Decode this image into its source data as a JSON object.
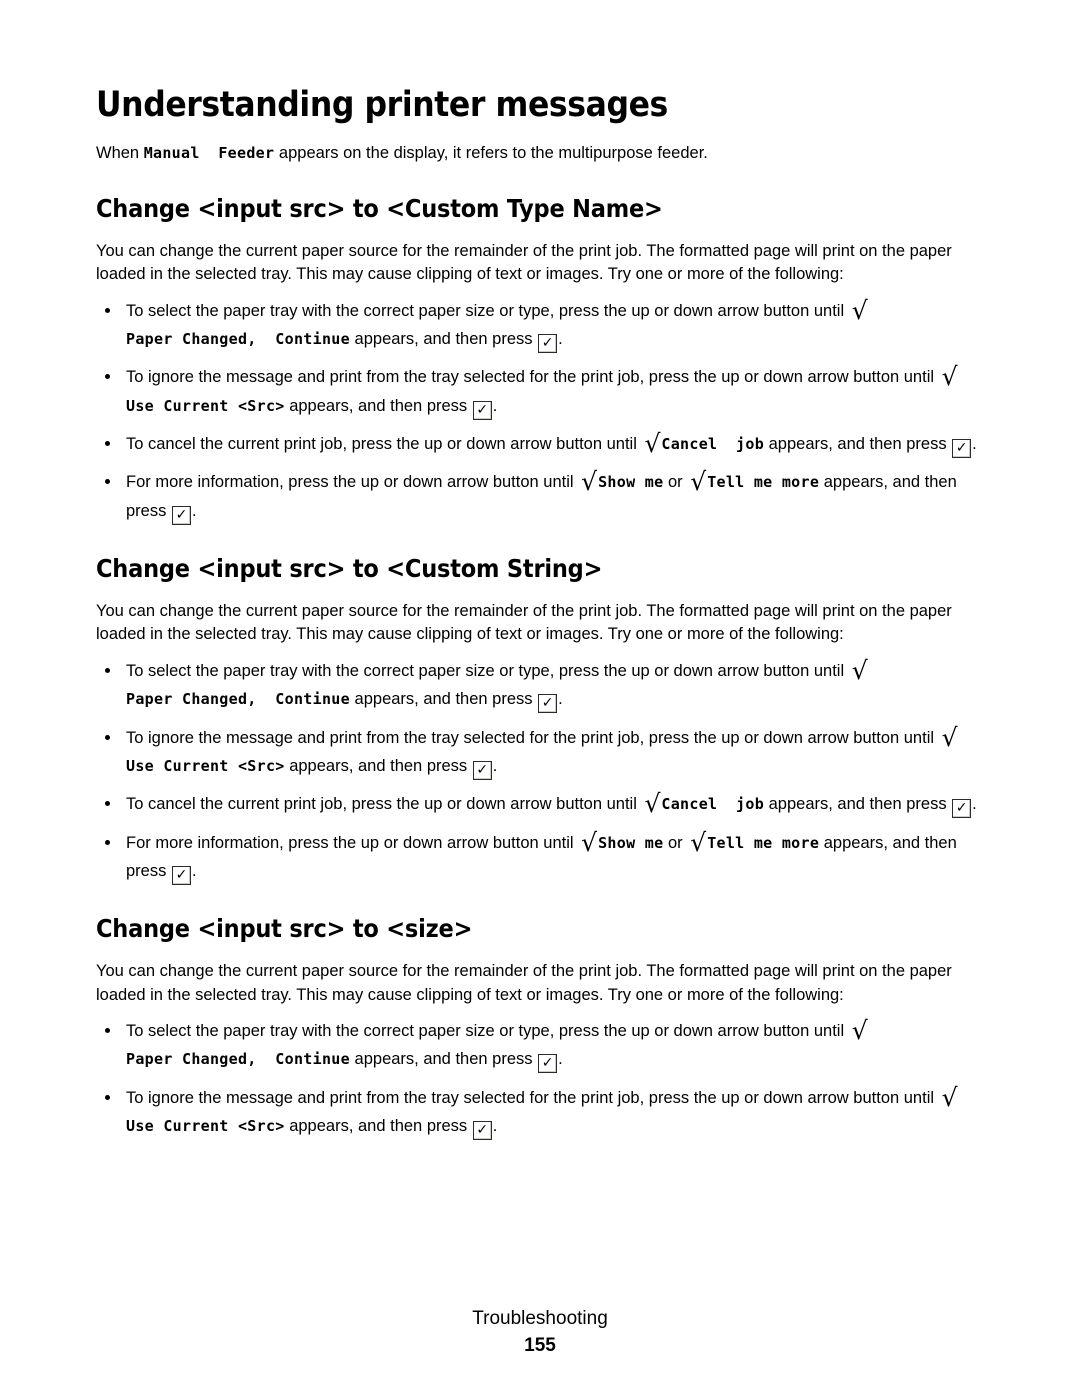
{
  "document": {
    "title": "Understanding printer messages",
    "intro": {
      "before": "When ",
      "mono": "Manual  Feeder",
      "after": " appears on the display, it refers to the multipurpose feeder."
    },
    "shared": {
      "paragraph_line1": "You can change the current paper source for the remainder of the print job. The formatted page will print on the",
      "paragraph_line2": "paper loaded in the selected tray. This may cause clipping of text or images. Try one or more of the following:",
      "paragraph": "You can change the current paper source for the remainder of the print job. The formatted page will print on the paper loaded in the selected tray. This may cause clipping of text or images. Try one or more of the following:",
      "bullet_select_before": "To select the paper tray with the correct paper size or type, press the up or down arrow button until ",
      "bullet_select_mono": "Paper Changed,  Continue",
      "bullet_select_mono_a": "Paper",
      "bullet_select_mono_b": "Changed,  Continue",
      "bullet_select_after": " appears, and then press ",
      "bullet_ignore_before": "To ignore the message and print from the tray selected for the print job, press the up or down arrow button until ",
      "bullet_ignore_mono": "Use Current <Src>",
      "bullet_ignore_after": " appears, and then press ",
      "bullet_cancel_before": "To cancel the current print job, press the up or down arrow button until ",
      "bullet_cancel_mono": "Cancel  job",
      "bullet_cancel_after": " appears, and then press ",
      "bullet_info_before": "For more information, press the up or down arrow button until ",
      "bullet_info_mono_a": "Show me",
      "bullet_info_or": " or ",
      "bullet_info_mono_b": "Tell me more",
      "bullet_info_after": " appears, and then press ",
      "period": ".",
      "radical_glyph": "√",
      "check_glyph": "✓"
    },
    "sections": [
      {
        "heading": "Change <input src> to <Custom Type Name>"
      },
      {
        "heading": "Change <input src> to <Custom String>"
      },
      {
        "heading": "Change <input src> to <size>"
      }
    ],
    "footer": {
      "label": "Troubleshooting",
      "page_number": "155"
    }
  }
}
